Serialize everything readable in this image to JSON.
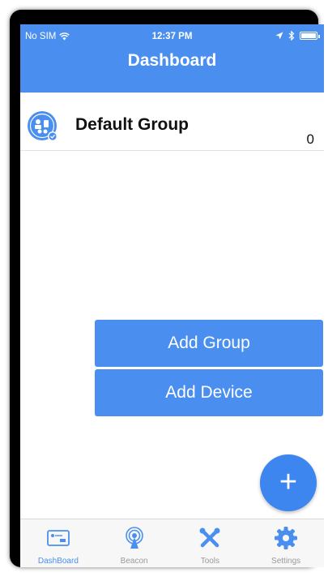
{
  "colors": {
    "accent": "#4a8ff0",
    "tab_inactive": "#9a9a9a"
  },
  "status_bar": {
    "carrier": "No SIM",
    "time": "12:37 PM",
    "icons": [
      "wifi-icon",
      "location-icon",
      "bluetooth-icon",
      "battery-icon"
    ]
  },
  "nav": {
    "title": "Dashboard"
  },
  "groups": [
    {
      "name": "Default Group",
      "count": "0",
      "icon": "group-devices-icon"
    }
  ],
  "actions": {
    "add_group": "Add Group",
    "add_device": "Add Device",
    "fab_label": "+"
  },
  "tabbar": {
    "tabs": [
      {
        "label": "DashBoard",
        "icon": "dashboard-icon",
        "active": true
      },
      {
        "label": "Beacon",
        "icon": "beacon-icon",
        "active": false
      },
      {
        "label": "Tools",
        "icon": "tools-icon",
        "active": false
      },
      {
        "label": "Settings",
        "icon": "settings-gear-icon",
        "active": false
      }
    ]
  }
}
